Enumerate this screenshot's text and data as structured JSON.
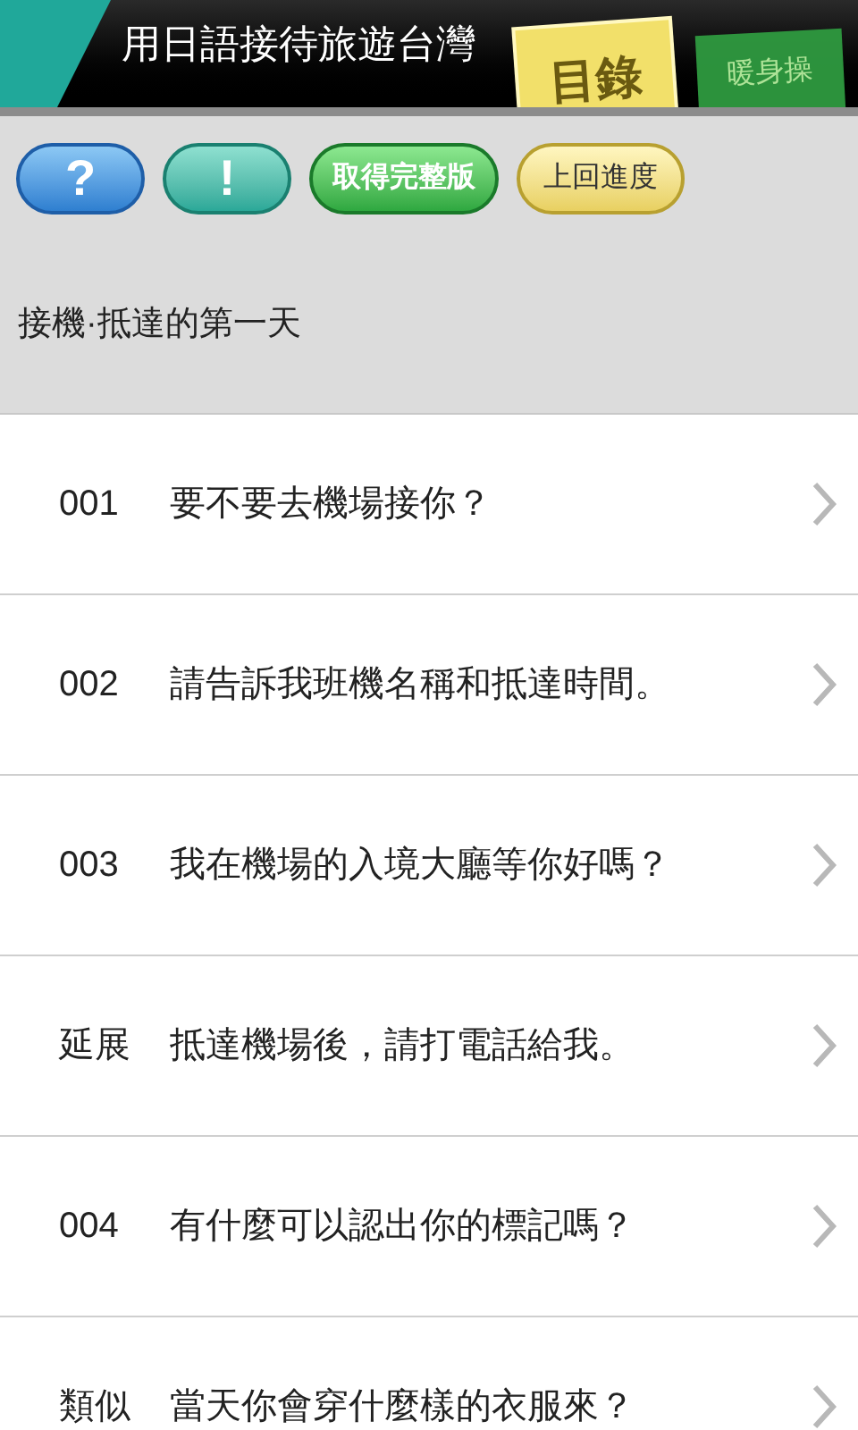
{
  "header": {
    "title": "用日語接待旅遊台灣",
    "tabs": [
      {
        "label": "目錄",
        "kind": "contents",
        "selected": true
      },
      {
        "label": "暖身操",
        "kind": "warmup",
        "selected": false
      }
    ]
  },
  "toolbar": [
    {
      "label": "?",
      "kind": "blue"
    },
    {
      "label": "!",
      "kind": "teal"
    },
    {
      "label": "取得完整版",
      "kind": "green"
    },
    {
      "label": "上回進度",
      "kind": "yellow"
    }
  ],
  "section_title": "接機·抵達的第一天",
  "items": [
    {
      "number": "001",
      "text": "要不要去機場接你？"
    },
    {
      "number": "002",
      "text": "請告訴我班機名稱和抵達時間。"
    },
    {
      "number": "003",
      "text": "我在機場的入境大廳等你好嗎？"
    },
    {
      "number": "延展",
      "text": "抵達機場後，請打電話給我。"
    },
    {
      "number": "004",
      "text": "有什麼可以認出你的標記嗎？"
    },
    {
      "number": "類似",
      "text": "當天你會穿什麼樣的衣服來？"
    }
  ]
}
